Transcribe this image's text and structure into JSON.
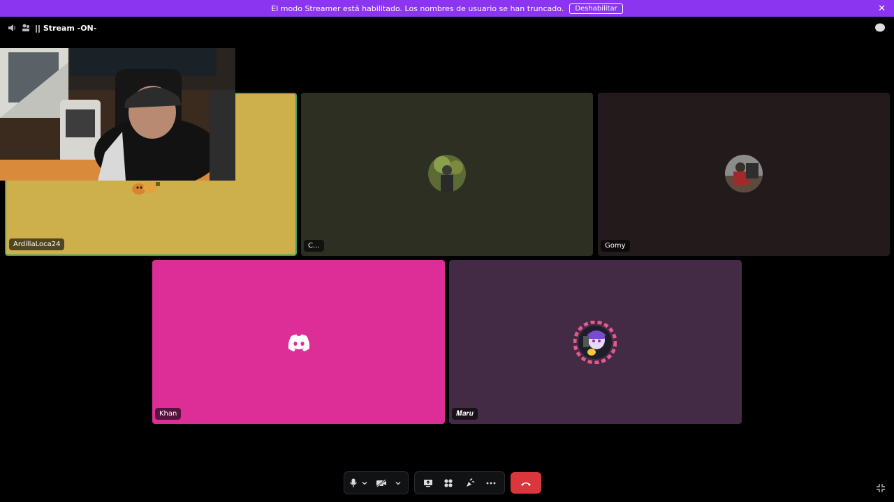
{
  "banner": {
    "message": "El modo Streamer está habilitado. Los nombres de usuario se han truncado.",
    "button": "Deshabilitar",
    "close": "✕"
  },
  "header": {
    "channel": "|| Stream -ON-"
  },
  "tiles": [
    {
      "name": "ArdillaLoca24",
      "color": "#cdb04c"
    },
    {
      "name": "C...",
      "color": "#2c2f22"
    },
    {
      "name": "Gomy",
      "color": "#231a1c"
    },
    {
      "name": "Khan",
      "color": "#dd2e98"
    },
    {
      "name": "𝑴𝒂𝒓𝒖",
      "color": "#442b45"
    }
  ],
  "controls": {
    "mute": "mic-icon",
    "camera": "camera-off-icon",
    "share": "screen-share-icon",
    "activities": "activities-icon",
    "soundboard": "soundboard-icon",
    "more": "more-icon",
    "disconnect": "hangup-icon"
  },
  "colors": {
    "banner": "#8c35f0",
    "speaking_border": "#3ba55c",
    "hangup": "#da373c"
  }
}
